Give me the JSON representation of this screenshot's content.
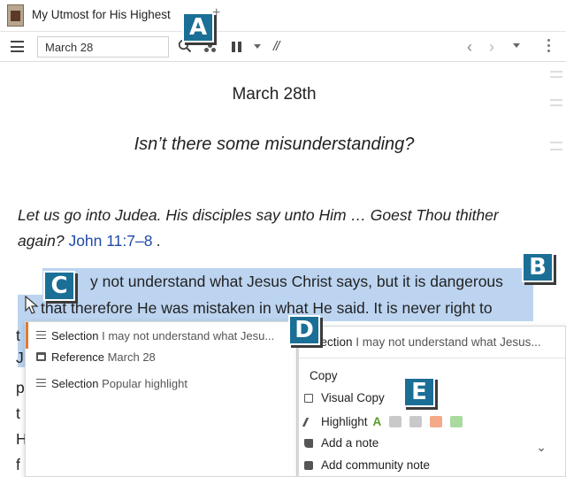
{
  "tab": {
    "title": "My Utmost for His Highest",
    "add_symbol": "+"
  },
  "toolbar": {
    "reference_value": "March 28",
    "slashes": "//",
    "back_arrow": "‹",
    "forward_arrow": "›"
  },
  "icons": [
    "book-thumbnail-icon",
    "hamburger-menu-icon",
    "search-icon",
    "dots-icon",
    "pause-icon",
    "chevron-down-icon",
    "more-vertical-icon",
    "cursor-icon"
  ],
  "document": {
    "date": "March 28th",
    "heading": "Isn’t there some misunderstanding?",
    "quote": "Let us go into Judea. His disciples say unto Him … Goest Thou thither again?",
    "verse_ref": "John 11:7–8",
    "after_ref": " .",
    "selected_line_1": "y not understand what Jesus Christ says, but it is dangerous",
    "selected_line_2": "that therefore He was mistaken in what He said. It is never right to",
    "line_letters": [
      "t",
      "J",
      "p",
      "t",
      "H",
      "f"
    ]
  },
  "popup_left": {
    "row1_label": "Selection",
    "row1_value": " I may not understand what Jesu...",
    "row2_label": "Reference",
    "row2_value": " March 28",
    "row3_label": "Selection",
    "row3_value": " Popular highlight"
  },
  "popup_right": {
    "header_label": "election",
    "header_value": " I may not understand what Jesus...",
    "copy": "Copy",
    "visual_copy": "Visual Copy",
    "highlight": "Highlight",
    "highlight_letter": "A",
    "add_note": "Add a note",
    "add_community_note": "Add community note",
    "chevron": "⌄"
  },
  "highlight_swatches": [
    "#c9c9c9",
    "#c9c9c9",
    "#f4a987",
    "#a9dba0"
  ],
  "badges": [
    "A",
    "B",
    "C",
    "D",
    "E"
  ],
  "colors": {
    "accent_blue": "#1b6f96",
    "selection": "#bcd4f0",
    "verse_link": "#1f4aa8",
    "highlight_green": "#5a9a2a",
    "active_accent": "#e07a2e"
  }
}
